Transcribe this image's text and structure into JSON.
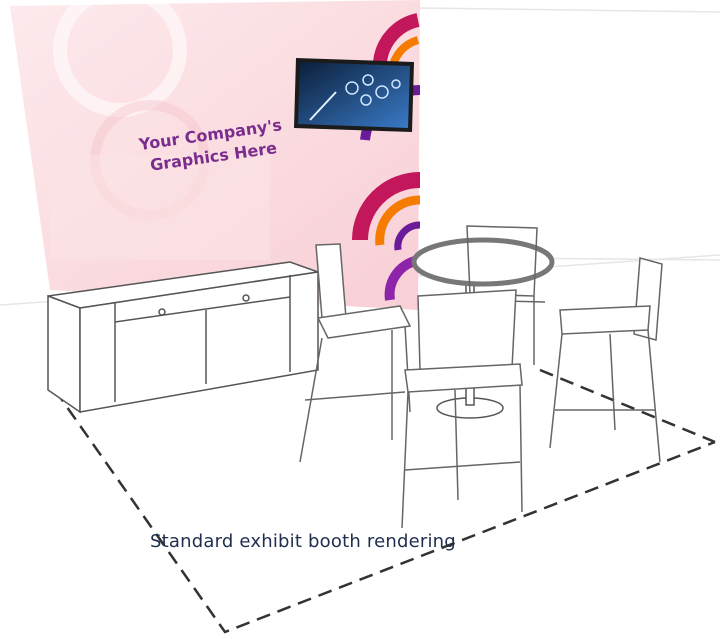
{
  "graphic_text": {
    "line1": "Your Company's",
    "line2": "Graphics Here"
  },
  "caption": "Standard exhibit booth rendering",
  "colors": {
    "backwall_pink": "#f9d8dc",
    "swirl_magenta": "#c2185b",
    "swirl_purple": "#6a1b9a",
    "swirl_orange": "#f57c00",
    "headline_purple": "#7b2d8e",
    "caption_navy": "#1f2d4f",
    "monitor_screen": "#1f4f8c"
  }
}
